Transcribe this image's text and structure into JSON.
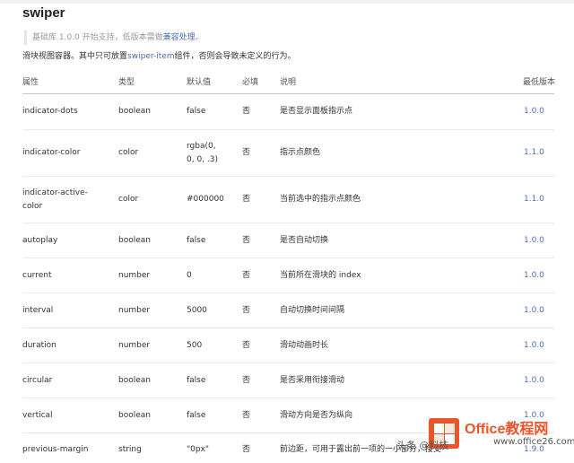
{
  "page": {
    "title": "swiper",
    "note_prefix": "基础库 1.0.0 开始支持，低版本需做",
    "note_link": "兼容处理",
    "note_suffix": "。",
    "intro_prefix": "滑块视图容器。其中只可放置",
    "intro_link": "swiper-item",
    "intro_suffix": "组件，否则会导致未定义的行为。"
  },
  "table": {
    "headers": {
      "name": "属性",
      "type": "类型",
      "default": "默认值",
      "required": "必填",
      "desc": "说明",
      "version": "最低版本"
    },
    "rows": [
      {
        "name": "indicator-dots",
        "type": "boolean",
        "default": "false",
        "required": "否",
        "desc": "是否显示面板指示点",
        "version": "1.0.0"
      },
      {
        "name": "indicator-color",
        "type": "color",
        "default": "rgba(0, 0, 0, .3)",
        "required": "否",
        "desc": "指示点颜色",
        "version": "1.1.0"
      },
      {
        "name": "indicator-active-color",
        "type": "color",
        "default": "#000000",
        "required": "否",
        "desc": "当前选中的指示点颜色",
        "version": "1.1.0"
      },
      {
        "name": "autoplay",
        "type": "boolean",
        "default": "false",
        "required": "否",
        "desc": "是否自动切换",
        "version": "1.0.0"
      },
      {
        "name": "current",
        "type": "number",
        "default": "0",
        "required": "否",
        "desc": "当前所在滑块的 index",
        "version": "1.0.0"
      },
      {
        "name": "interval",
        "type": "number",
        "default": "5000",
        "required": "否",
        "desc": "自动切换时间间隔",
        "version": "1.0.0"
      },
      {
        "name": "duration",
        "type": "number",
        "default": "500",
        "required": "否",
        "desc": "滑动动画时长",
        "version": "1.0.0"
      },
      {
        "name": "circular",
        "type": "boolean",
        "default": "false",
        "required": "否",
        "desc": "是否采用衔接滑动",
        "version": "1.0.0"
      },
      {
        "name": "vertical",
        "type": "boolean",
        "default": "false",
        "required": "否",
        "desc": "滑动方向是否为纵向",
        "version": "1.0.0"
      },
      {
        "name": "previous-margin",
        "type": "string",
        "default": "\"0px\"",
        "required": "否",
        "desc": "前边距，可用于露出前一项的一小部分，接受",
        "version": "1.9.0"
      }
    ]
  },
  "watermark": {
    "main": "Office教程网",
    "sub": "www.office26.com",
    "account": "头条 @科技"
  },
  "colors": {
    "link": "#4a6fb5",
    "watermark": "#e8562a"
  }
}
